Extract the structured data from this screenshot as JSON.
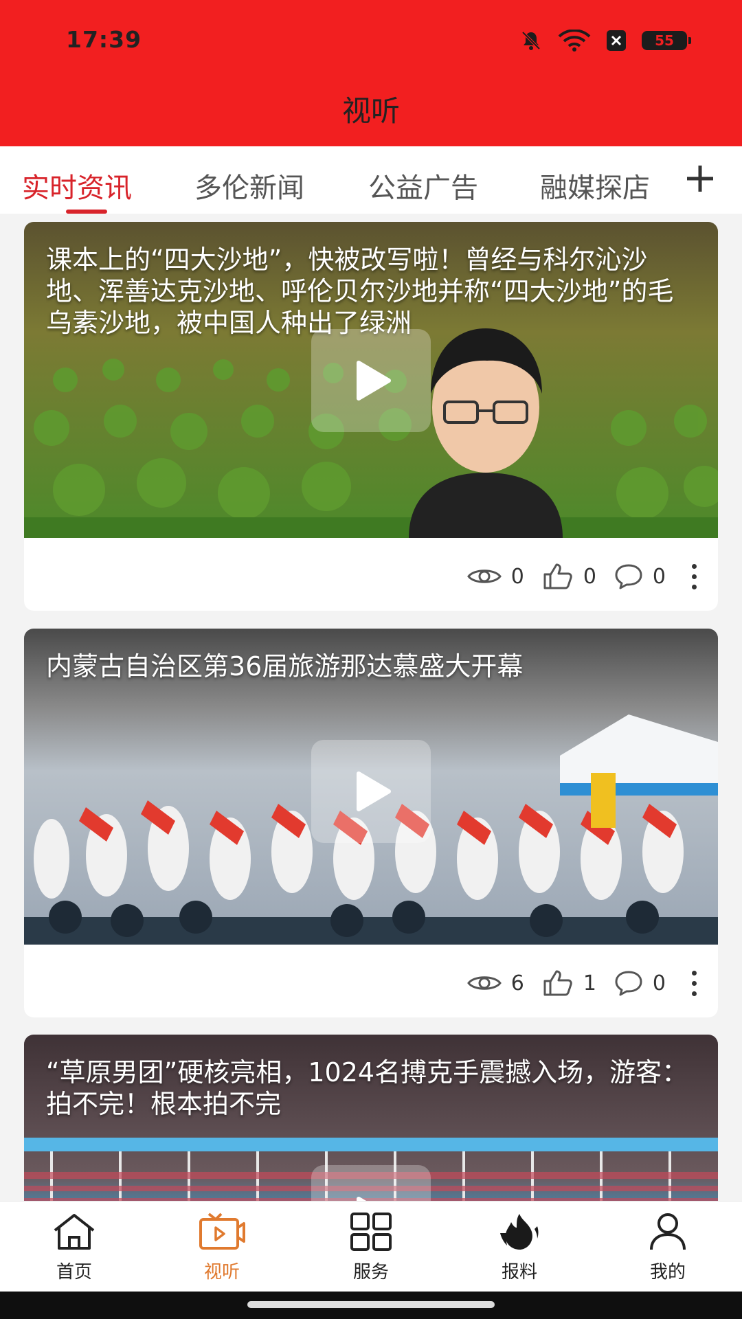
{
  "status_bar": {
    "time": "17:39",
    "battery": "55"
  },
  "header": {
    "title": "视听"
  },
  "tabs": [
    {
      "label": "实时资讯",
      "active": true
    },
    {
      "label": "多伦新闻",
      "active": false
    },
    {
      "label": "公益广告",
      "active": false
    },
    {
      "label": "融媒探店",
      "active": false
    }
  ],
  "feed": [
    {
      "title": "课本上的“四大沙地”，快被改写啦！曾经与科尔沁沙地、浑善达克沙地、呼伦贝尔沙地并称“四大沙地”的毛乌素沙地，被中国人种出了绿洲",
      "views": "0",
      "likes": "0",
      "comments": "0"
    },
    {
      "title": "内蒙古自治区第36届旅游那达慕盛大开幕",
      "views": "6",
      "likes": "1",
      "comments": "0"
    },
    {
      "title": "“草原男团”硬核亮相，1024名搏克手震撼入场，游客：拍不完！根本拍不完"
    }
  ],
  "bottom_nav": [
    {
      "label": "首页",
      "icon": "home-icon",
      "active": false
    },
    {
      "label": "视听",
      "icon": "tv-play-icon",
      "active": true
    },
    {
      "label": "服务",
      "icon": "grid-icon",
      "active": false
    },
    {
      "label": "报料",
      "icon": "fire-icon",
      "active": false
    },
    {
      "label": "我的",
      "icon": "user-icon",
      "active": false
    }
  ],
  "colors": {
    "brand_red": "#f21f20",
    "active_tab": "#d8232a",
    "active_nav": "#e07a2f"
  }
}
